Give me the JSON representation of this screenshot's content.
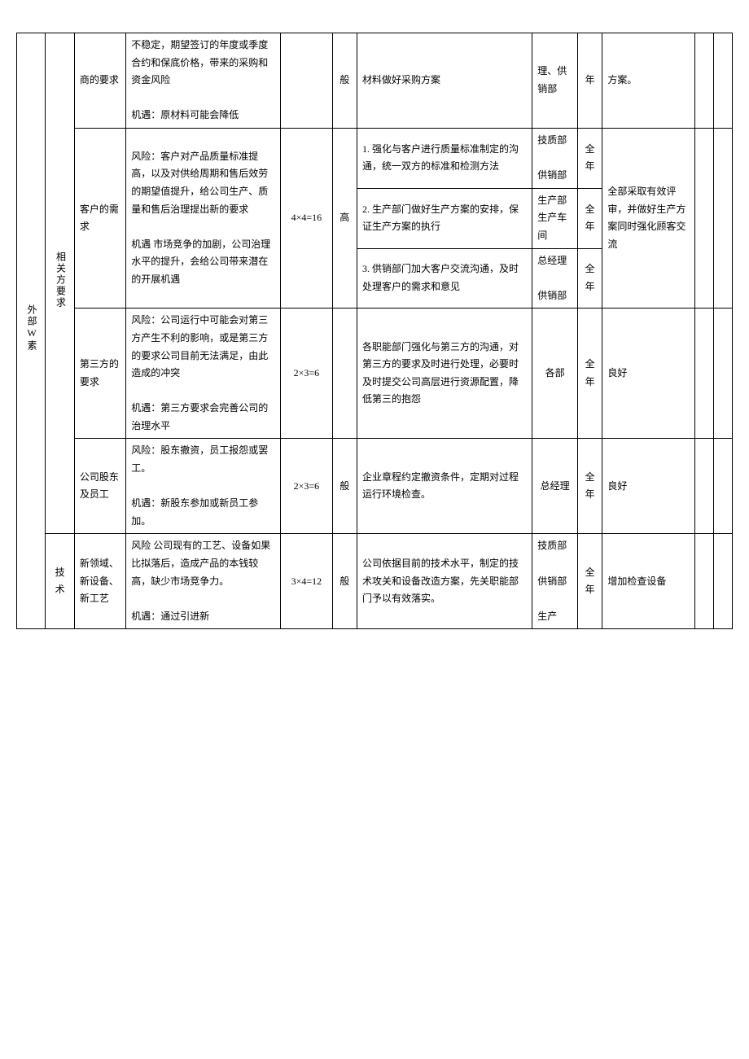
{
  "outer": {
    "label": "外部W素"
  },
  "group_related": "相关方要求",
  "group_tech": "技术",
  "rows": {
    "r1": {
      "c3": "商的要求",
      "c4": "不稳定，期望签订的年度或季度合约和保底价格，带来的采购和资金风险\n\n机遇：原材料可能会降低",
      "c5": "",
      "c6": "般",
      "c7": "材料做好采购方案",
      "c8": "理、供销部",
      "c9": "年",
      "c10": "方案。"
    },
    "r2": {
      "c3": "客户的需求",
      "c4": "风险：客户对产品质量标准提高，以及对供给周期和售后效劳的期望值提升，给公司生产、质量和售后治理提出新的要求\n\n机遇 市场竞争的加剧，公司治理水平的提升，会给公司带来潜在的开展机遇",
      "c5": "4×4=16",
      "c6": "高",
      "c7a": "1. 强化与客户进行质量标准制定的沟通，统一双方的标准和检测方法",
      "c7b": "2. 生产部门做好生产方案的安排，保证生产方案的执行",
      "c7c": "3. 供销部门加大客户交流沟通，及时处理客户的需求和意见",
      "c8a": "技质部\n\n供销部",
      "c8b": "生产部生产车间",
      "c8c": "总经理\n\n供销部",
      "c9a": "全年",
      "c9b": "全年",
      "c9c": "全年",
      "c10": "全部采取有效评审，并做好生产方案同时强化顾客交流"
    },
    "r3": {
      "c3": "第三方的要求",
      "c4": "风险：公司运行中可能会对第三方产生不利的影响，或是第三方的要求公司目前无法满足，由此造成的冲突\n\n机遇：第三方要求会完善公司的治理水平",
      "c5": "2×3=6",
      "c6": "",
      "c7": "各职能部门强化与第三方的沟通，对第三方的要求及时进行处理，必要时及时提交公司高层进行资源配置，降低第三的抱怨",
      "c8": "各部",
      "c9": "全年",
      "c10": "良好"
    },
    "r4": {
      "c3": "公司股东及员工",
      "c4": "风险：股东撤资，员工报怨或罢工。\n\n机遇：新股东参加或新员工参加。",
      "c5": "2×3=6",
      "c6": "般",
      "c7": "企业章程约定撤资条件，定期对过程运行环境检查。",
      "c8": "总经理",
      "c9": "全年",
      "c10": "良好"
    },
    "r5": {
      "c3": "新领域、新设备、新工艺",
      "c4": "风险 公司现有的工艺、设备如果比拟落后，造成产品的本钱较高，缺少市场竞争力。\n\n机遇：通过引进新",
      "c5": "3×4=12",
      "c6": "般",
      "c7": "公司依据目前的技术水平，制定的技术攻关和设备改造方案，先关职能部门予以有效落实。",
      "c8": "技质部\n\n供销部\n\n生产",
      "c9": "全年",
      "c10": "增加检查设备"
    }
  }
}
